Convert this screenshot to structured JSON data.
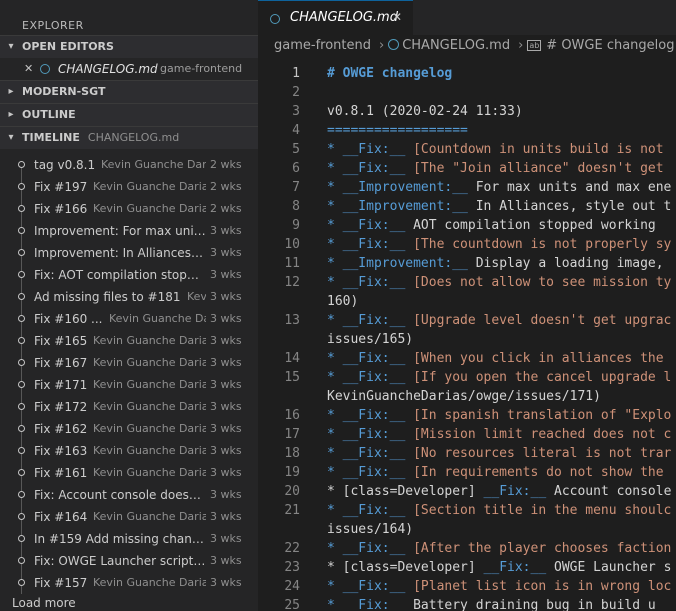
{
  "sidebar": {
    "title": "EXPLORER",
    "open_editors": {
      "label": "OPEN EDITORS",
      "items": [
        {
          "name": "CHANGELOG.md",
          "dir": "game-frontend"
        }
      ]
    },
    "sections": [
      {
        "label": "MODERN-SGT"
      },
      {
        "label": "OUTLINE"
      }
    ],
    "timeline": {
      "label": "TIMELINE",
      "file": "CHANGELOG.md",
      "items": [
        {
          "title": "tag v0.8.1",
          "author": "Kevin Guanche Dar...",
          "age": "2 wks"
        },
        {
          "title": "Fix #197",
          "author": "Kevin Guanche Darias",
          "age": "2 wks"
        },
        {
          "title": "Fix #166",
          "author": "Kevin Guanche Darias",
          "age": "2 wks"
        },
        {
          "title": "Improvement: For max units...",
          "author": "",
          "age": "3 wks"
        },
        {
          "title": "Improvement: In Alliances, s...",
          "author": "",
          "age": "3 wks"
        },
        {
          "title": "Fix: AOT compilation stoppe...",
          "author": "",
          "age": "3 wks"
        },
        {
          "title": "Ad missing files to #181",
          "author": "Kevin ...",
          "age": "3 wks"
        },
        {
          "title": "Fix #160 ...",
          "author": "Kevin Guanche Darias",
          "age": "3 wks"
        },
        {
          "title": "Fix #165",
          "author": "Kevin Guanche Darias",
          "age": "3 wks"
        },
        {
          "title": "Fix #167",
          "author": "Kevin Guanche Darias",
          "age": "3 wks"
        },
        {
          "title": "Fix #171",
          "author": "Kevin Guanche Darias",
          "age": "3 wks"
        },
        {
          "title": "Fix #172",
          "author": "Kevin Guanche Darias",
          "age": "3 wks"
        },
        {
          "title": "Fix #162",
          "author": "Kevin Guanche Darias",
          "age": "3 wks"
        },
        {
          "title": "Fix #163",
          "author": "Kevin Guanche Darias",
          "age": "3 wks"
        },
        {
          "title": "Fix #161",
          "author": "Kevin Guanche Darias",
          "age": "3 wks"
        },
        {
          "title": "Fix: Account console doesn't...",
          "author": "",
          "age": "3 wks"
        },
        {
          "title": "Fix #164",
          "author": "Kevin Guanche Darias",
          "age": "3 wks"
        },
        {
          "title": "In #159 Add missing chang...",
          "author": "",
          "age": "3 wks"
        },
        {
          "title": "Fix: OWGE Launcher script f...",
          "author": "",
          "age": "3 wks"
        },
        {
          "title": "Fix #157",
          "author": "Kevin Guanche Darias",
          "age": "3 wks"
        }
      ],
      "load_more": "Load more"
    }
  },
  "editor": {
    "tab": {
      "name": "CHANGELOG.md"
    },
    "breadcrumb": {
      "folder": "game-frontend",
      "file": "CHANGELOG.md",
      "symbol": "# OWGE changelog"
    },
    "lines": [
      {
        "n": "1",
        "parts": [
          {
            "c": "h1",
            "t": "# OWGE changelog"
          }
        ]
      },
      {
        "n": "2",
        "parts": []
      },
      {
        "n": "3",
        "parts": [
          {
            "c": "plain",
            "t": "v0.8.1 (2020-02-24 11:33)"
          }
        ]
      },
      {
        "n": "4",
        "parts": [
          {
            "c": "hr",
            "t": "=================="
          }
        ]
      },
      {
        "n": "5",
        "parts": [
          {
            "c": "blue",
            "t": "* __Fix:__ "
          },
          {
            "c": "red",
            "t": "[Countdown in units build is not"
          }
        ]
      },
      {
        "n": "6",
        "parts": [
          {
            "c": "blue",
            "t": "* __Fix:__ "
          },
          {
            "c": "red",
            "t": "[The \"Join alliance\" doesn't get"
          }
        ]
      },
      {
        "n": "7",
        "parts": [
          {
            "c": "blue",
            "t": "* __Improvement:__ "
          },
          {
            "c": "plain",
            "t": "For max units and max ene"
          }
        ]
      },
      {
        "n": "8",
        "parts": [
          {
            "c": "blue",
            "t": "* __Improvement:__ "
          },
          {
            "c": "plain",
            "t": "In Alliances, style out t"
          }
        ]
      },
      {
        "n": "9",
        "parts": [
          {
            "c": "blue",
            "t": "* __Fix:__ "
          },
          {
            "c": "plain",
            "t": "AOT compilation stopped working"
          }
        ]
      },
      {
        "n": "10",
        "parts": [
          {
            "c": "blue",
            "t": "* __Fix:__ "
          },
          {
            "c": "red",
            "t": "[The countdown is not properly sy"
          }
        ]
      },
      {
        "n": "11",
        "parts": [
          {
            "c": "blue",
            "t": "* __Improvement:__ "
          },
          {
            "c": "plain",
            "t": "Display a loading image,"
          }
        ]
      },
      {
        "n": "12",
        "parts": [
          {
            "c": "blue",
            "t": "* __Fix:__ "
          },
          {
            "c": "red",
            "t": "[Does not allow to see mission ty"
          }
        ]
      },
      {
        "n": "",
        "parts": [
          {
            "c": "plain",
            "t": "160)"
          }
        ]
      },
      {
        "n": "13",
        "parts": [
          {
            "c": "blue",
            "t": "* __Fix:__ "
          },
          {
            "c": "red",
            "t": "[Upgrade level doesn't get upgrac"
          }
        ]
      },
      {
        "n": "",
        "parts": [
          {
            "c": "plain",
            "t": "issues/165)"
          }
        ]
      },
      {
        "n": "14",
        "parts": [
          {
            "c": "blue",
            "t": "* __Fix:__ "
          },
          {
            "c": "red",
            "t": "[When you click in alliances the"
          }
        ]
      },
      {
        "n": "15",
        "parts": [
          {
            "c": "blue",
            "t": "* __Fix:__ "
          },
          {
            "c": "red",
            "t": "[If you open the cancel upgrade l"
          }
        ]
      },
      {
        "n": "",
        "parts": [
          {
            "c": "plain",
            "t": "KevinGuancheDarias/owge/issues/171)"
          }
        ]
      },
      {
        "n": "16",
        "parts": [
          {
            "c": "blue",
            "t": "* __Fix:__ "
          },
          {
            "c": "red",
            "t": "[In spanish translation of \"Explo"
          }
        ]
      },
      {
        "n": "17",
        "parts": [
          {
            "c": "blue",
            "t": "* __Fix:__ "
          },
          {
            "c": "red",
            "t": "[Mission limit reached does not c"
          }
        ]
      },
      {
        "n": "18",
        "parts": [
          {
            "c": "blue",
            "t": "* __Fix:__ "
          },
          {
            "c": "red",
            "t": "[No resources literal is not trar"
          }
        ]
      },
      {
        "n": "19",
        "parts": [
          {
            "c": "blue",
            "t": "* __Fix:__ "
          },
          {
            "c": "red",
            "t": "[In requirements do not show the"
          }
        ]
      },
      {
        "n": "20",
        "parts": [
          {
            "c": "plain",
            "t": "* [class=Developer] "
          },
          {
            "c": "blue",
            "t": "__Fix:__ "
          },
          {
            "c": "plain",
            "t": "Account console"
          }
        ]
      },
      {
        "n": "21",
        "parts": [
          {
            "c": "blue",
            "t": "* __Fix:__ "
          },
          {
            "c": "red",
            "t": "[Section title in the menu shoulc"
          }
        ]
      },
      {
        "n": "",
        "parts": [
          {
            "c": "plain",
            "t": "issues/164)"
          }
        ]
      },
      {
        "n": "22",
        "parts": [
          {
            "c": "blue",
            "t": "* __Fix:__ "
          },
          {
            "c": "red",
            "t": "[After the player chooses faction"
          }
        ]
      },
      {
        "n": "23",
        "parts": [
          {
            "c": "plain",
            "t": "* [class=Developer] "
          },
          {
            "c": "blue",
            "t": "__Fix:__ "
          },
          {
            "c": "plain",
            "t": "OWGE Launcher s"
          }
        ]
      },
      {
        "n": "24",
        "parts": [
          {
            "c": "blue",
            "t": "* __Fix:__ "
          },
          {
            "c": "red",
            "t": "[Planet list icon is in wrong loc"
          }
        ]
      },
      {
        "n": "25",
        "parts": [
          {
            "c": "blue",
            "t": "* __Fix:__ "
          },
          {
            "c": "plain",
            "t": "Battery draining bug in build u"
          }
        ]
      }
    ]
  }
}
